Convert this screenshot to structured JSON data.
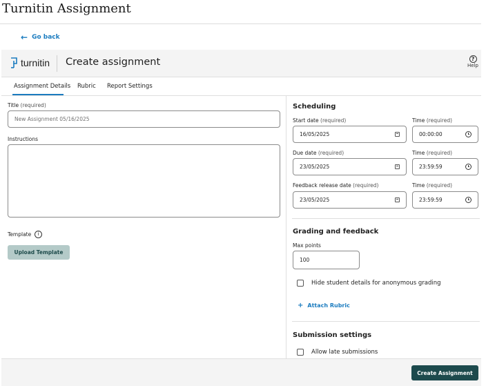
{
  "page": {
    "title": "Turnitin Assignment"
  },
  "nav": {
    "go_back": "Go back"
  },
  "header": {
    "logo_text": "turnitin",
    "title": "Create assignment",
    "help_label": "Help"
  },
  "tabs": [
    {
      "label": "Assignment Details",
      "active": true
    },
    {
      "label": "Rubric",
      "active": false
    },
    {
      "label": "Report Settings",
      "active": false
    }
  ],
  "form": {
    "title_label": "Title",
    "title_required": "(required)",
    "title_placeholder": "New Assignment 05/16/2025",
    "instructions_label": "Instructions",
    "template_label": "Template",
    "upload_template": "Upload Template"
  },
  "scheduling": {
    "heading": "Scheduling",
    "start_date_label": "Start date",
    "due_date_label": "Due date",
    "feedback_date_label": "Feedback release date",
    "time_label": "Time",
    "required": "(required)",
    "start_date": "16/05/2025",
    "start_time": "00:00:00",
    "due_date": "23/05/2025",
    "due_time": "23:59:59",
    "feedback_date": "23/05/2025",
    "feedback_time": "23:59:59"
  },
  "grading": {
    "heading": "Grading and feedback",
    "max_points_label": "Max points",
    "max_points": "100",
    "hide_student_details": "Hide student details for anonymous grading",
    "attach_rubric": "Attach Rubric"
  },
  "submission": {
    "heading": "Submission settings",
    "allow_late": "Allow late submissions"
  },
  "footer": {
    "create_button": "Create Assignment"
  },
  "colors": {
    "accent": "#1a7bbf",
    "primary_button": "#1d4a4d",
    "secondary_button": "#b4cac8"
  }
}
